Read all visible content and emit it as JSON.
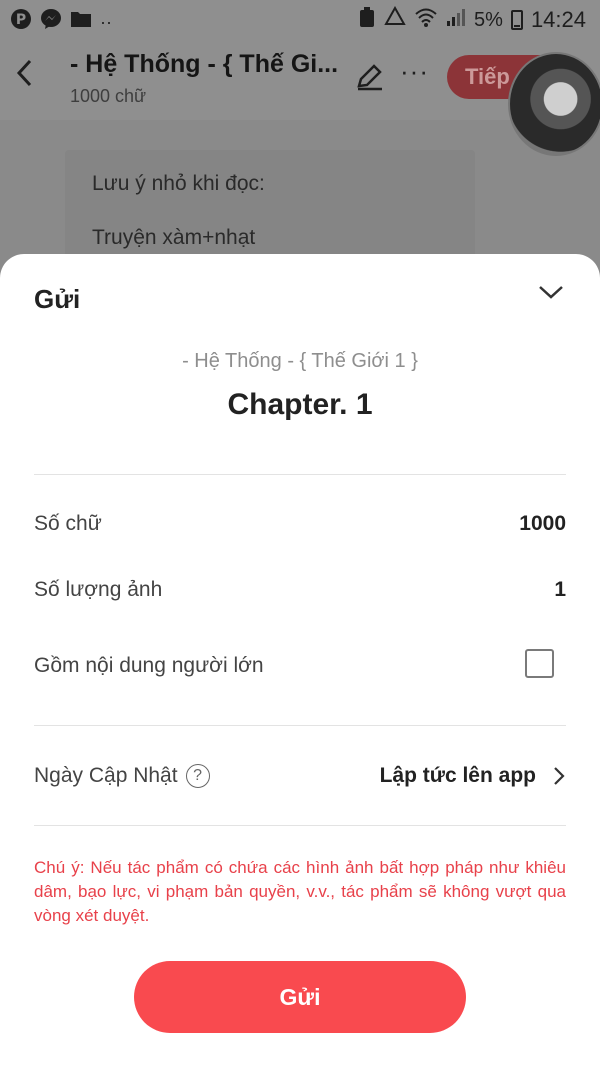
{
  "status_bar": {
    "battery": "5%",
    "time": "14:24"
  },
  "header": {
    "title": "- Hệ Thống - { Thế Gi...",
    "word_count": "1000 chữ",
    "next_label": "Tiếp"
  },
  "background": {
    "note_line1": "Lưu ý nhỏ khi đọc:",
    "note_line2": "Truyện xàm+nhạt"
  },
  "sheet": {
    "title": "Gửi",
    "book_name": "- Hệ Thống - { Thế Giới 1 }",
    "chapter_name": "Chapter. 1",
    "rows": {
      "word_count_label": "Số chữ",
      "word_count_value": "1000",
      "image_count_label": "Số lượng ảnh",
      "image_count_value": "1",
      "adult_label": "Gồm nội dung người lớn",
      "adult_checked": false
    },
    "update": {
      "label": "Ngày Cập Nhật",
      "help_glyph": "?",
      "value": "Lập tức lên app"
    },
    "warning": "Chú ý: Nếu tác phẩm có chứa các hình ảnh bất hợp pháp như khiêu dâm, bạo lực, vi phạm bản quyền, v.v., tác phẩm sẽ không vượt qua vòng xét duyệt.",
    "submit_label": "Gửi"
  },
  "colors": {
    "accent": "#f94a4f",
    "warning": "#e8414a"
  },
  "icons": [
    "pinterest-icon",
    "messenger-icon",
    "folder-icon",
    "recycle-icon",
    "wifi-icon",
    "signal-icon",
    "battery-icon",
    "back-arrow-icon",
    "pencil-icon",
    "more-icon",
    "chevron-down-icon",
    "help-icon",
    "chevron-right-icon"
  ]
}
